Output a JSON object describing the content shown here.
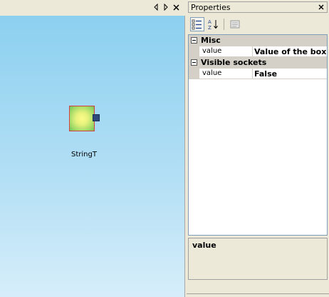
{
  "canvas": {
    "node": {
      "label": "StringT"
    }
  },
  "properties_panel": {
    "title": "Properties",
    "toolbar": {
      "categorized_icon": "categorized-icon",
      "alphabetical_icon": "alphabetical-icon",
      "property_pages_icon": "property-pages-icon"
    },
    "categories": [
      {
        "name": "Misc",
        "properties": [
          {
            "name": "value",
            "value": "Value of the box"
          }
        ]
      },
      {
        "name": "Visible sockets",
        "properties": [
          {
            "name": "value",
            "value": "False"
          }
        ]
      }
    ],
    "description": {
      "title": "value"
    }
  },
  "colors": {
    "canvas_top": "#8cd0f0",
    "canvas_bottom": "#d6eefa",
    "node_border": "#d64040",
    "node_socket": "#2e4a7a",
    "panel_bg": "#ece9d8",
    "category_bg": "#d4d0c8"
  }
}
